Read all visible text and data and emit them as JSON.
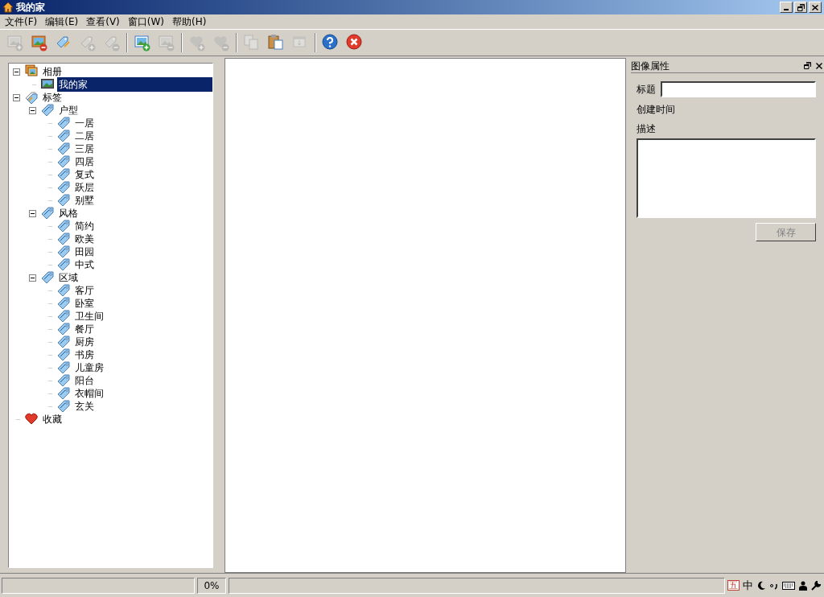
{
  "window": {
    "title": "我的家"
  },
  "menu": [
    "文件(F)",
    "编辑(E)",
    "查看(V)",
    "窗口(W)",
    "帮助(H)"
  ],
  "toolbar": [
    {
      "kind": "add-picture",
      "disabled": true,
      "group_start": false
    },
    {
      "kind": "remove-picture",
      "disabled": false,
      "group_start": false
    },
    {
      "kind": "tag-edit",
      "disabled": false,
      "group_start": false
    },
    {
      "kind": "tag-add",
      "disabled": true,
      "group_start": false
    },
    {
      "kind": "tag-remove",
      "disabled": true,
      "group_start": false
    },
    {
      "kind": "import-picture",
      "disabled": false,
      "group_start": true
    },
    {
      "kind": "export-picture",
      "disabled": true,
      "group_start": false
    },
    {
      "kind": "heart-add",
      "disabled": true,
      "group_start": true
    },
    {
      "kind": "heart-remove",
      "disabled": true,
      "group_start": false
    },
    {
      "kind": "copy",
      "disabled": true,
      "group_start": true
    },
    {
      "kind": "paste",
      "disabled": false,
      "group_start": false
    },
    {
      "kind": "screen",
      "disabled": true,
      "group_start": false
    },
    {
      "kind": "help",
      "disabled": false,
      "group_start": true
    },
    {
      "kind": "close",
      "disabled": false,
      "group_start": false
    }
  ],
  "tree": [
    {
      "label": "相册",
      "kind": "album",
      "expanded": true,
      "selected": false,
      "children": [
        {
          "label": "我的家",
          "kind": "photo",
          "selected": true
        }
      ]
    },
    {
      "label": "标签",
      "kind": "tags",
      "expanded": true,
      "selected": false,
      "children": [
        {
          "label": "户型",
          "kind": "tag",
          "expanded": true,
          "selected": false,
          "children": [
            {
              "label": "一居",
              "kind": "tag",
              "selected": false
            },
            {
              "label": "二居",
              "kind": "tag",
              "selected": false
            },
            {
              "label": "三居",
              "kind": "tag",
              "selected": false
            },
            {
              "label": "四居",
              "kind": "tag",
              "selected": false
            },
            {
              "label": "复式",
              "kind": "tag",
              "selected": false
            },
            {
              "label": "跃层",
              "kind": "tag",
              "selected": false
            },
            {
              "label": "别墅",
              "kind": "tag",
              "selected": false
            }
          ]
        },
        {
          "label": "风格",
          "kind": "tag",
          "expanded": true,
          "selected": false,
          "children": [
            {
              "label": "简约",
              "kind": "tag",
              "selected": false
            },
            {
              "label": "欧美",
              "kind": "tag",
              "selected": false
            },
            {
              "label": "田园",
              "kind": "tag",
              "selected": false
            },
            {
              "label": "中式",
              "kind": "tag",
              "selected": false
            }
          ]
        },
        {
          "label": "区域",
          "kind": "tag",
          "expanded": true,
          "selected": false,
          "children": [
            {
              "label": "客厅",
              "kind": "tag",
              "selected": false
            },
            {
              "label": "卧室",
              "kind": "tag",
              "selected": false
            },
            {
              "label": "卫生间",
              "kind": "tag",
              "selected": false
            },
            {
              "label": "餐厅",
              "kind": "tag",
              "selected": false
            },
            {
              "label": "厨房",
              "kind": "tag",
              "selected": false
            },
            {
              "label": "书房",
              "kind": "tag",
              "selected": false
            },
            {
              "label": "儿童房",
              "kind": "tag",
              "selected": false
            },
            {
              "label": "阳台",
              "kind": "tag",
              "selected": false
            },
            {
              "label": "衣帽间",
              "kind": "tag",
              "selected": false
            },
            {
              "label": "玄关",
              "kind": "tag",
              "selected": false
            }
          ]
        }
      ]
    },
    {
      "label": "收藏",
      "kind": "favorites",
      "selected": false
    }
  ],
  "properties": {
    "title": "图像属性",
    "title_label": "标题",
    "created_label": "创建时间",
    "description_label": "描述",
    "save_button": {
      "label": "保存",
      "disabled": true
    }
  },
  "status_bar": {
    "progress": "0%",
    "ime": [
      "五",
      "中"
    ]
  }
}
